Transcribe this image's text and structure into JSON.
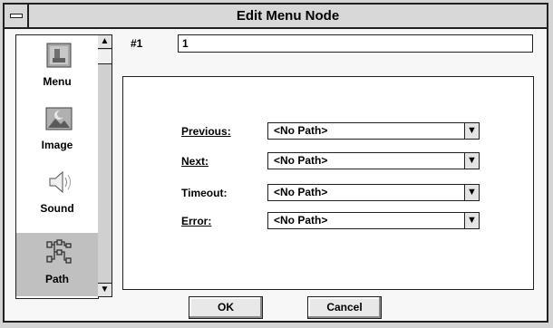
{
  "window": {
    "title": "Edit Menu Node"
  },
  "sidebar": {
    "items": [
      {
        "label": "Menu",
        "icon": "menu-icon"
      },
      {
        "label": "Image",
        "icon": "image-icon"
      },
      {
        "label": "Sound",
        "icon": "speaker-icon"
      },
      {
        "label": "Path",
        "icon": "path-icon",
        "selected": true
      }
    ]
  },
  "node": {
    "id_label": "#1",
    "id_value": "1"
  },
  "paths": [
    {
      "label": "Previous:",
      "value": "<No Path>"
    },
    {
      "label": "Next:",
      "value": "<No Path>"
    },
    {
      "label": "Timeout:",
      "value": "<No Path>"
    },
    {
      "label": "Error:",
      "value": "<No Path>"
    }
  ],
  "buttons": {
    "ok": "OK",
    "cancel": "Cancel"
  }
}
